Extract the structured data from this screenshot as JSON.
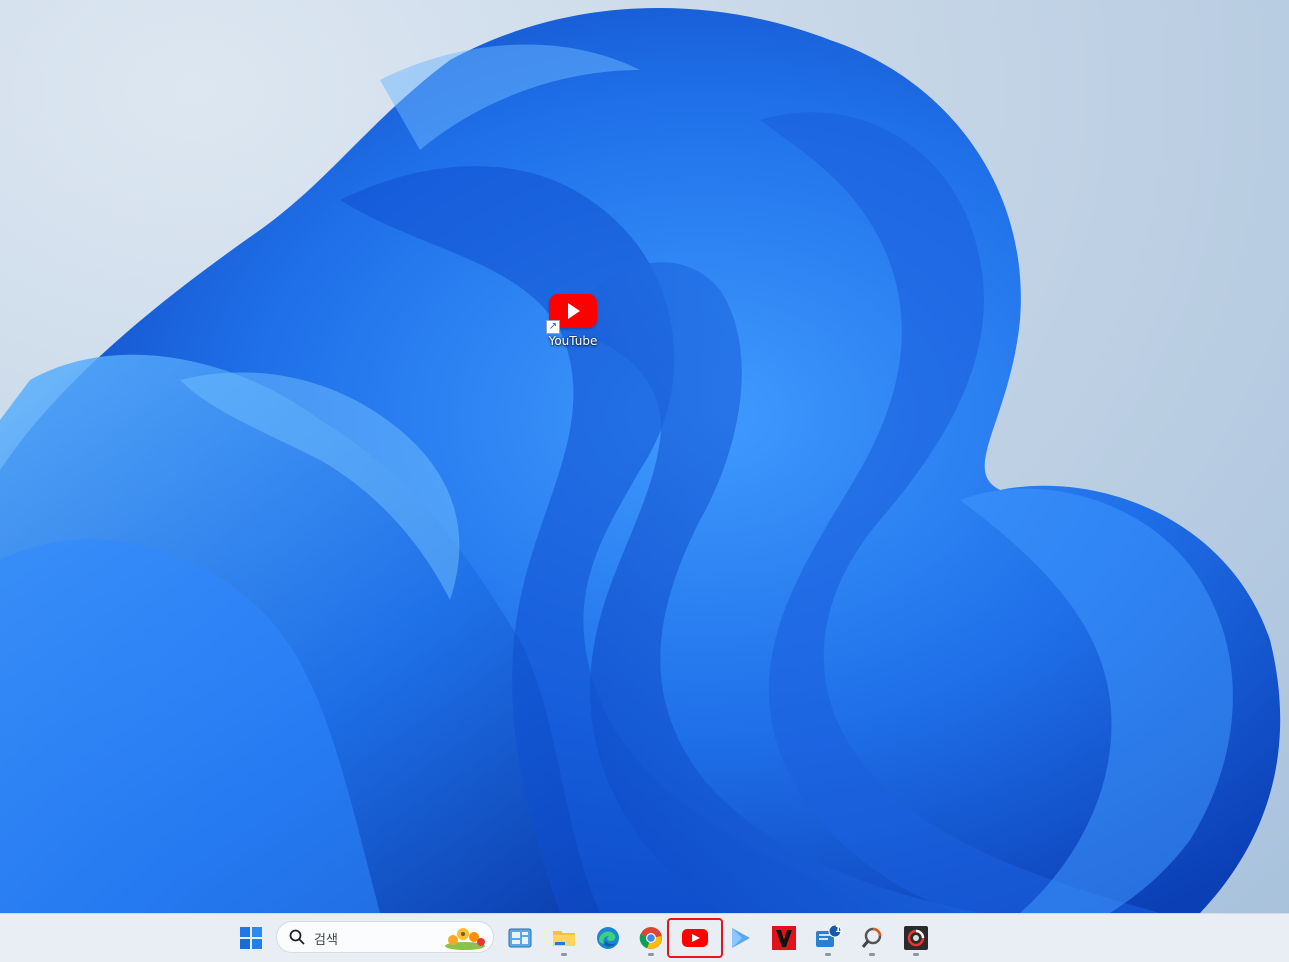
{
  "desktop": {
    "icons": [
      {
        "label": "YouTube",
        "icon": "youtube-icon"
      }
    ]
  },
  "taskbar": {
    "search": {
      "placeholder": "검색"
    },
    "items": [
      {
        "name": "start-button",
        "icon": "windows-logo-icon"
      },
      {
        "name": "widgets-button",
        "icon": "widgets-icon"
      },
      {
        "name": "file-explorer",
        "icon": "folder-icon"
      },
      {
        "name": "edge",
        "icon": "edge-icon"
      },
      {
        "name": "chrome",
        "icon": "chrome-icon"
      },
      {
        "name": "youtube",
        "icon": "youtube-icon",
        "highlight_color": "#e8141c"
      },
      {
        "name": "play-app",
        "icon": "play-triangle-icon"
      },
      {
        "name": "v-app",
        "icon": "v-logo-icon"
      },
      {
        "name": "messenger-app",
        "icon": "chat-badge-icon",
        "badge": "1"
      },
      {
        "name": "search-tool",
        "icon": "magnifier-tool-icon"
      },
      {
        "name": "capture-app",
        "icon": "camera-icon"
      }
    ]
  },
  "colors": {
    "accent": "#1f6fe0",
    "highlight": "#e8141c",
    "youtube": "#ff0000"
  }
}
